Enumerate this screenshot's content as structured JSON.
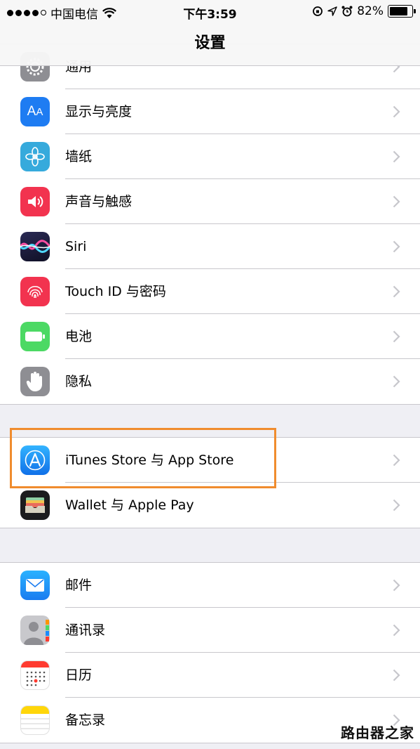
{
  "status_bar": {
    "carrier": "中国电信",
    "time": "下午3:59",
    "battery": "82%",
    "battery_level": 0.82
  },
  "nav": {
    "title": "设置"
  },
  "groups": [
    {
      "items": [
        {
          "label": "通用",
          "icon": "gear-icon"
        },
        {
          "label": "显示与亮度",
          "icon": "display-brightness-icon",
          "color": "#1e7cf2"
        },
        {
          "label": "墙纸",
          "icon": "wallpaper-flower-icon",
          "color": "#36aadc"
        },
        {
          "label": "声音与触感",
          "icon": "speaker-icon",
          "color": "#f2334f"
        },
        {
          "label": "Siri",
          "icon": "siri-icon",
          "color": "#1b1b3a"
        },
        {
          "label": "Touch ID 与密码",
          "icon": "fingerprint-icon",
          "color": "#f2334f"
        },
        {
          "label": "电池",
          "icon": "battery-icon",
          "color": "#4cd964"
        },
        {
          "label": "隐私",
          "icon": "hand-icon",
          "color": "#8e8e93"
        }
      ]
    },
    {
      "items": [
        {
          "label": "iTunes Store 与 App Store",
          "icon": "app-store-icon",
          "color": "#1a8cff"
        },
        {
          "label": "Wallet 与 Apple Pay",
          "icon": "wallet-icon",
          "color": "#1c1c1e"
        }
      ]
    },
    {
      "items": [
        {
          "label": "邮件",
          "icon": "mail-icon",
          "color": "#1a8cff"
        },
        {
          "label": "通讯录",
          "icon": "contacts-icon",
          "color": "#a8a8ac"
        },
        {
          "label": "日历",
          "icon": "calendar-icon",
          "color": "#ffffff"
        },
        {
          "label": "备忘录",
          "icon": "notes-icon",
          "color": "#ffd60a"
        }
      ]
    }
  ],
  "watermark": "路由器之家"
}
